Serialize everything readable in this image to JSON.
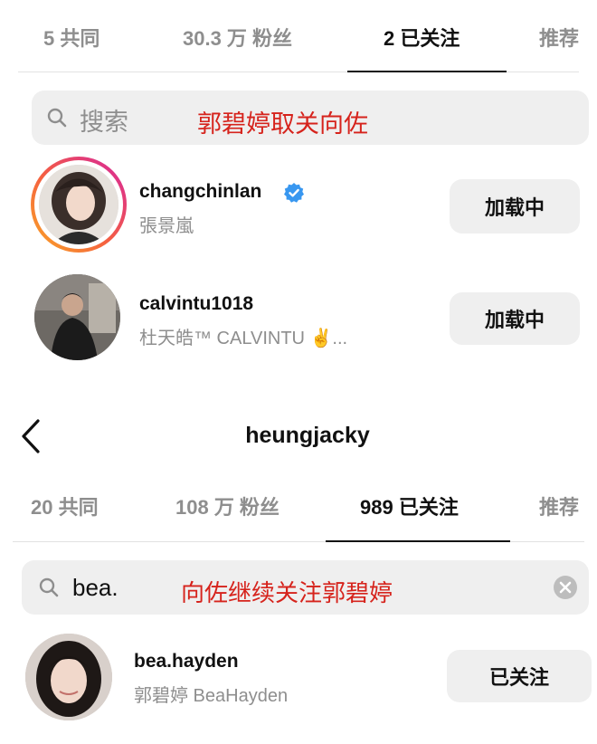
{
  "top": {
    "tabs": [
      {
        "label": "5 共同"
      },
      {
        "label": "30.3 万 粉丝"
      },
      {
        "label": "2 已关注"
      },
      {
        "label": "推荐"
      }
    ],
    "search": {
      "placeholder": "搜索"
    },
    "annotation": "郭碧婷取关向佐",
    "users": [
      {
        "username": "changchinlan",
        "full_name": "張景嵐",
        "verified": true,
        "button": "加载中"
      },
      {
        "username": "calvintu1018",
        "full_name": "杜天皓™ CALVINTU ✌️...",
        "button": "加载中"
      }
    ]
  },
  "bottom": {
    "header": {
      "title": "heungjacky",
      "back_icon": "chevron-left-icon"
    },
    "tabs": [
      {
        "label": "20 共同"
      },
      {
        "label": "108 万 粉丝"
      },
      {
        "label": "989 已关注"
      },
      {
        "label": "推荐"
      }
    ],
    "search": {
      "value": "bea."
    },
    "annotation": "向佐继续关注郭碧婷",
    "users": [
      {
        "username": "bea.hayden",
        "full_name": "郭碧婷 BeaHayden",
        "button": "已关注"
      }
    ]
  },
  "colors": {
    "annotation": "#d6231c",
    "verified": "#3897f0",
    "story_ring_start": "#f9a825",
    "story_ring_end": "#d6249f"
  }
}
